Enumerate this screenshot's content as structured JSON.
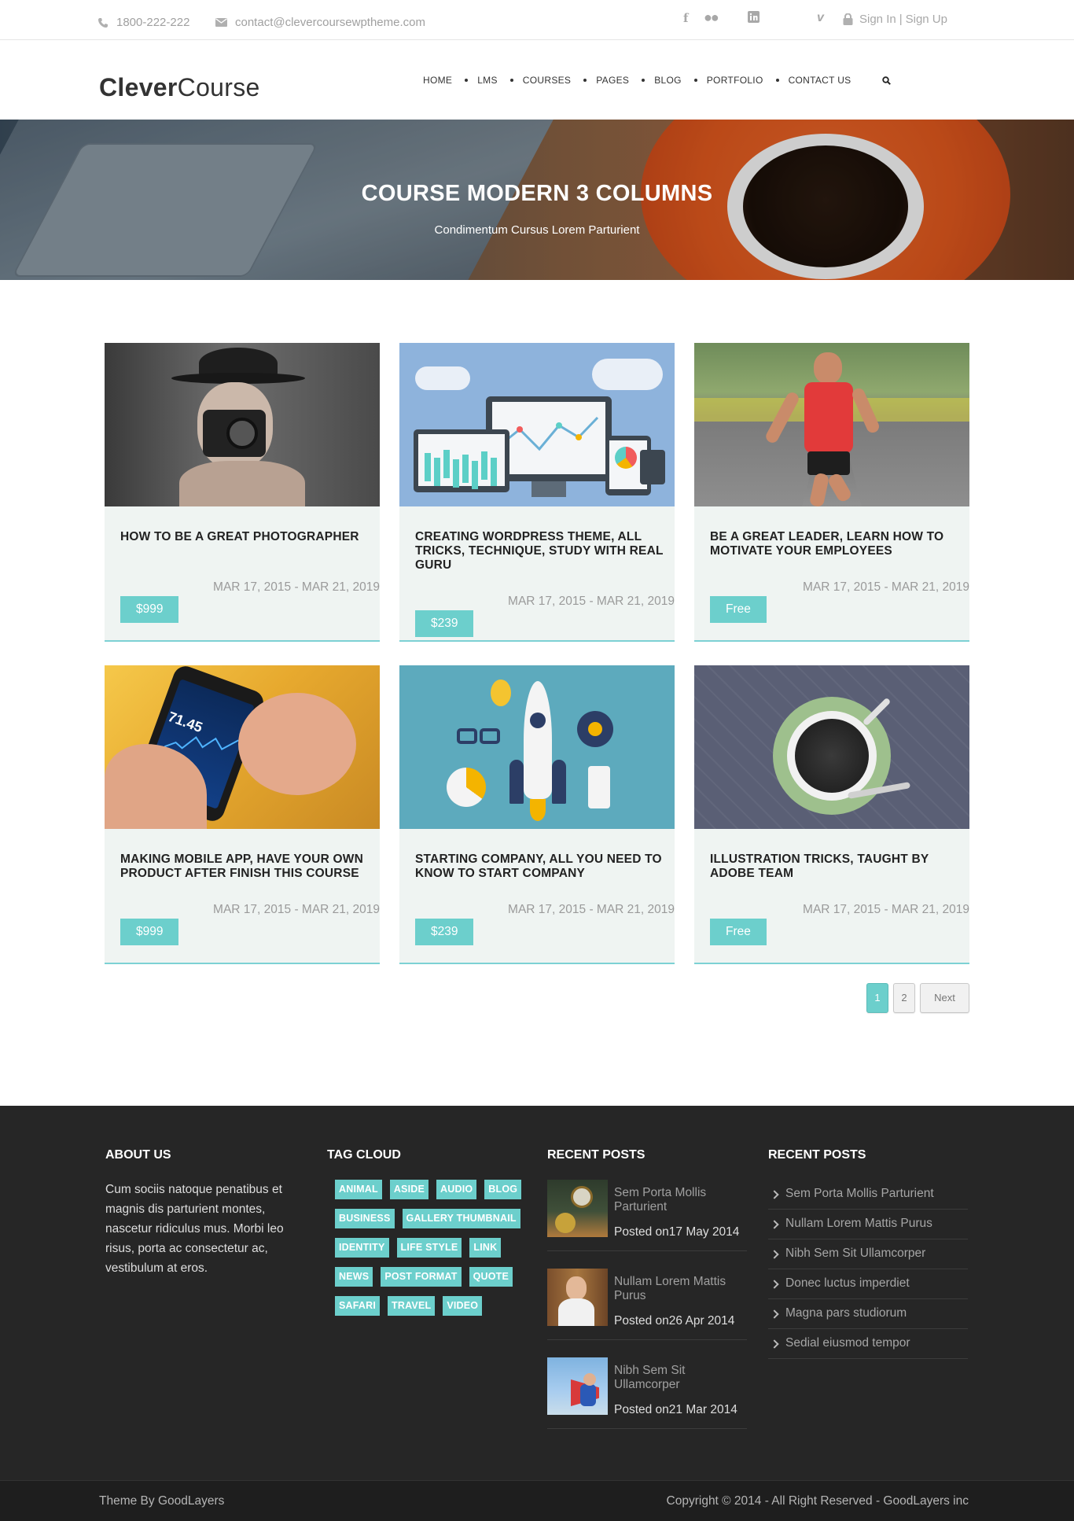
{
  "topbar": {
    "phone": "1800-222-222",
    "email": "contact@clevercoursewptheme.com",
    "social": [
      "facebook-icon",
      "flickr-icon",
      "linkedin-icon",
      "vimeo-icon"
    ],
    "sign_in": "Sign In",
    "separator": "|",
    "sign_up": "Sign Up"
  },
  "header": {
    "logo_bold": "Clever",
    "logo_light": "Course",
    "nav": [
      "HOME",
      "LMS",
      "COURSES",
      "PAGES",
      "BLOG",
      "PORTFOLIO",
      "CONTACT US"
    ]
  },
  "hero": {
    "title": "COURSE MODERN 3 COLUMNS",
    "subtitle": "Condimentum Cursus Lorem Parturient"
  },
  "courses": [
    {
      "title": "HOW TO BE A GREAT PHOTOGRAPHER",
      "date": "MAR 17, 2015 - MAR 21, 2019",
      "price": "$999"
    },
    {
      "title": "CREATING WORDPRESS THEME, ALL TRICKS, TECHNIQUE, STUDY WITH REAL GURU",
      "date": "MAR 17, 2015 - MAR 21, 2019",
      "price": "$239"
    },
    {
      "title": "BE A GREAT LEADER, LEARN HOW TO MOTIVATE YOUR EMPLOYEES",
      "date": "MAR 17, 2015 - MAR 21, 2019",
      "price": "Free"
    },
    {
      "title": "MAKING MOBILE APP, HAVE YOUR OWN PRODUCT AFTER FINISH THIS COURSE",
      "date": "MAR 17, 2015 - MAR 21, 2019",
      "price": "$999"
    },
    {
      "title": "STARTING COMPANY, ALL YOU NEED TO KNOW TO START COMPANY",
      "date": "MAR 17, 2015 - MAR 21, 2019",
      "price": "$239"
    },
    {
      "title": "ILLUSTRATION TRICKS, TAUGHT BY ADOBE TEAM",
      "date": "MAR 17, 2015 - MAR 21, 2019",
      "price": "Free"
    }
  ],
  "pagination": {
    "pages": [
      "1",
      "2"
    ],
    "next": "Next"
  },
  "footer": {
    "about_title": "ABOUT US",
    "about_text": "Cum sociis natoque penatibus et magnis dis parturient montes, nascetur ridiculus mus. Morbi leo risus, porta ac consectetur ac, vestibulum at eros.",
    "tag_title": "TAG CLOUD",
    "tags": [
      "ANIMAL",
      "ASIDE",
      "AUDIO",
      "BLOG",
      "BUSINESS",
      "GALLERY THUMBNAIL",
      "IDENTITY",
      "LIFE STYLE",
      "LINK",
      "NEWS",
      "POST FORMAT",
      "QUOTE",
      "SAFARI",
      "TRAVEL",
      "VIDEO"
    ],
    "recent_title": "RECENT POSTS",
    "recent_posts": [
      {
        "title": "Sem Porta Mollis Parturient",
        "date": "Posted on17 May 2014"
      },
      {
        "title": "Nullam Lorem Mattis Purus",
        "date": "Posted on26 Apr 2014"
      },
      {
        "title": "Nibh Sem Sit Ullamcorper",
        "date": "Posted on21 Mar 2014"
      }
    ],
    "recent_title_2": "RECENT POSTS",
    "recent_list": [
      "Sem Porta Mollis Parturient",
      "Nullam Lorem Mattis Purus",
      "Nibh Sem Sit Ullamcorper",
      "Donec luctus imperdiet",
      "Magna pars studiorum",
      "Sedial eiusmod tempor"
    ]
  },
  "copyright": {
    "left": "Theme By GoodLayers",
    "right": "Copyright © 2014 - All Right Reserved - GoodLayers inc"
  },
  "colors": {
    "accent": "#6ccfcc",
    "footer_bg": "#262626",
    "card_bg": "#eff4f2"
  }
}
